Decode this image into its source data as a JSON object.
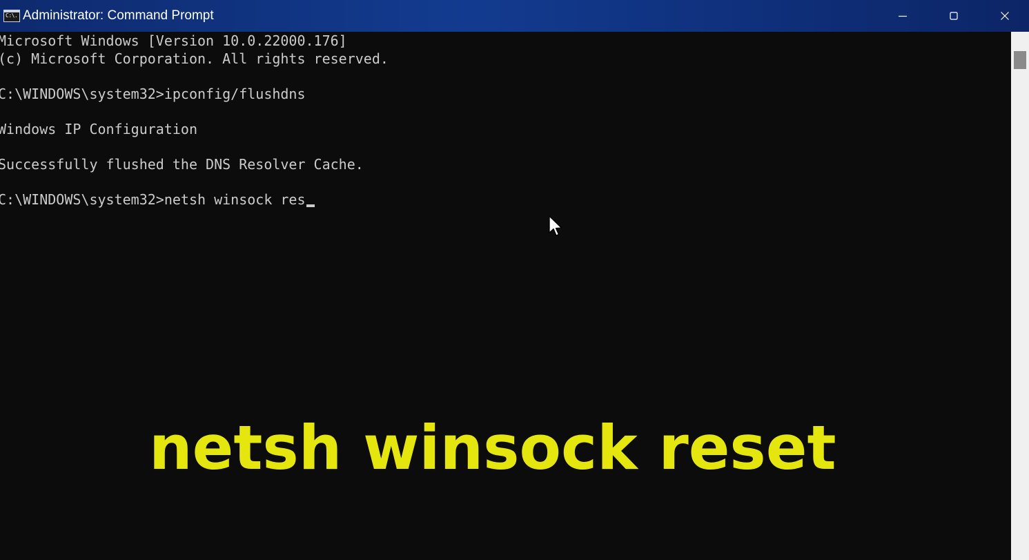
{
  "window": {
    "title": "Administrator: Command Prompt",
    "icon": "cmd-icon",
    "icon_text": "C:\\.",
    "controls": {
      "minimize": "minimize-icon",
      "maximize": "maximize-icon",
      "close": "close-icon"
    }
  },
  "console": {
    "lines": [
      "Microsoft Windows [Version 10.0.22000.176]",
      "(c) Microsoft Corporation. All rights reserved.",
      "",
      "C:\\WINDOWS\\system32>ipconfig/flushdns",
      "",
      "Windows IP Configuration",
      "",
      "Successfully flushed the DNS Resolver Cache.",
      "",
      "C:\\WINDOWS\\system32>netsh winsock res"
    ],
    "text_color": "#cccccc",
    "background": "#0c0c0c"
  },
  "overlay": {
    "caption": "netsh winsock reset",
    "color": "#e6e60f"
  },
  "theme": {
    "titlebar": "#123b8f",
    "scrollbar_track": "#f0f0f0",
    "scrollbar_thumb": "#8a8a8a"
  }
}
